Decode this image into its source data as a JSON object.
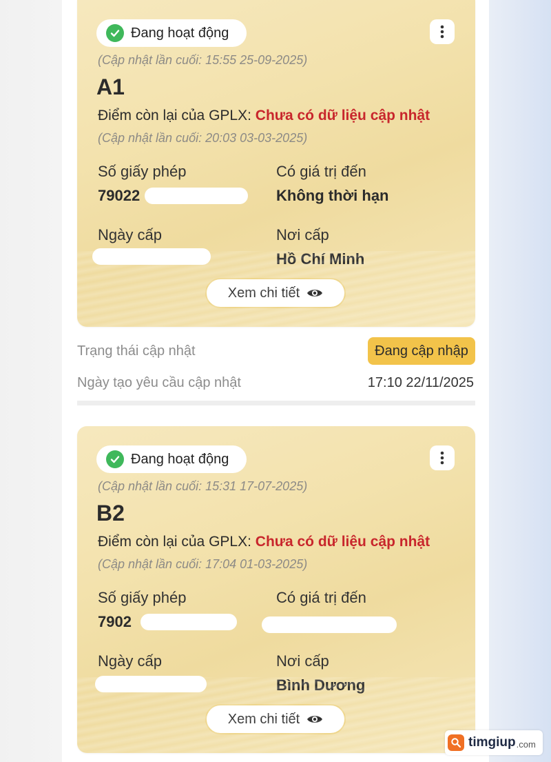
{
  "cards": [
    {
      "status": "Đang hoạt động",
      "last_updated": "(Cập nhật lần cuối: 15:55 25-09-2025)",
      "license_class": "A1",
      "points_label": "Điểm còn lại của GPLX:",
      "points_value": "Chưa có dữ liệu cập nhật",
      "points_updated": "(Cập nhật lần cuối: 20:03 03-03-2025)",
      "license_no_label": "Số giấy phép",
      "license_no_value": "79022",
      "valid_until_label": "Có giá trị đến",
      "valid_until_value": "Không thời hạn",
      "issue_date_label": "Ngày cấp",
      "issue_date_value": "",
      "issue_place_label": "Nơi cấp",
      "issue_place_value": "Hồ Chí Minh",
      "detail_button": "Xem chi tiết"
    },
    {
      "status": "Đang hoạt động",
      "last_updated": "(Cập nhật lần cuối: 15:31 17-07-2025)",
      "license_class": "B2",
      "points_label": "Điểm còn lại của GPLX:",
      "points_value": "Chưa có dữ liệu cập nhật",
      "points_updated": "(Cập nhật lần cuối: 17:04 01-03-2025)",
      "license_no_label": "Số giấy phép",
      "license_no_value": "7902",
      "valid_until_label": "Có giá trị đến",
      "valid_until_value": "",
      "issue_date_label": "Ngày cấp",
      "issue_date_value": "",
      "issue_place_label": "Nơi cấp",
      "issue_place_value": "Bình Dương",
      "detail_button": "Xem chi tiết"
    }
  ],
  "update_status_label": "Trạng thái cập nhật",
  "update_status_value": "Đang cập nhập",
  "request_date_label": "Ngày tạo yêu cầu cập nhật",
  "request_date_value": "17:10 22/11/2025",
  "watermark": {
    "brand": "timgiup",
    "domain": ".com"
  },
  "colors": {
    "active": "#3fb85b",
    "warning_text": "#c8262c",
    "badge": "#f2c34a",
    "brand": "#f07024"
  },
  "icons": [
    "check-circle-icon",
    "more-vertical-icon",
    "eye-icon",
    "search-icon"
  ]
}
